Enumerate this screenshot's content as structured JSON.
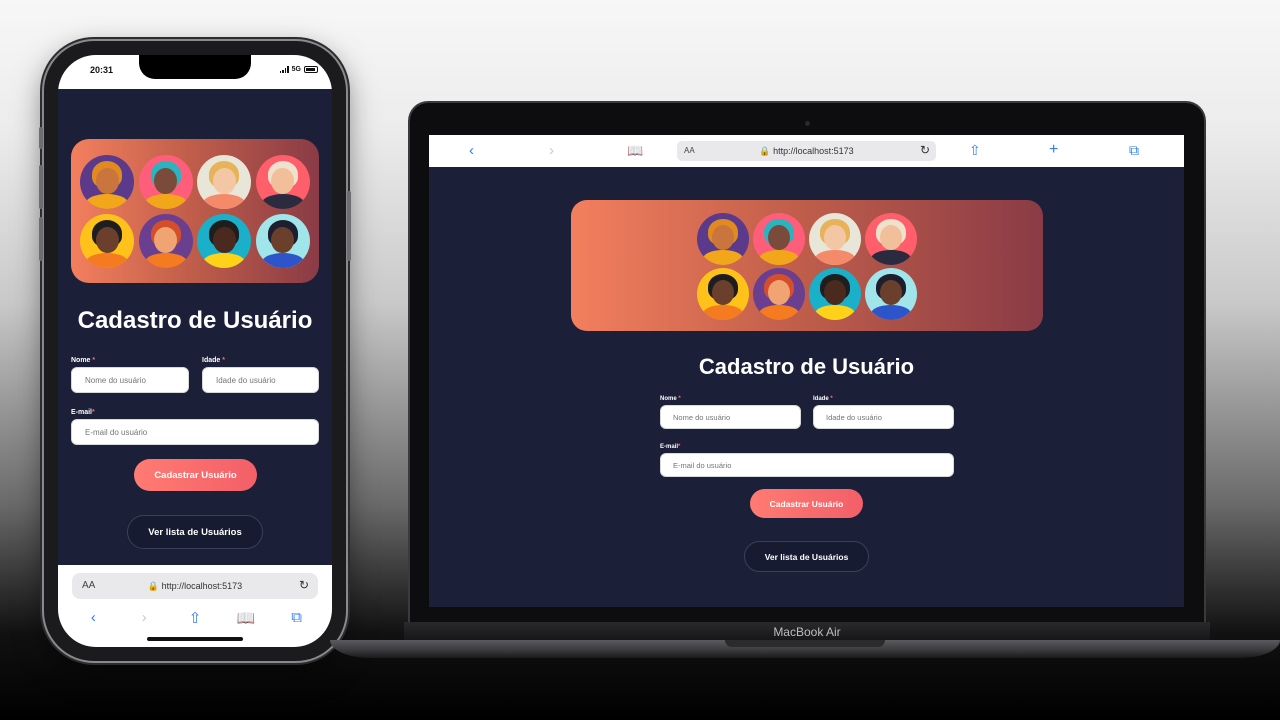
{
  "phone": {
    "status": {
      "time": "20:31",
      "network": "5G"
    },
    "app": {
      "title": "Cadastro de Usuário",
      "name_label": "Nome",
      "age_label": "Idade",
      "email_label": "E-mail",
      "required_mark": "*",
      "name_placeholder": "Nome do usuário",
      "age_placeholder": "Idade do usuário",
      "email_placeholder": "E-mail do usuário",
      "submit_label": "Cadastrar Usuário",
      "list_label": "Ver lista de Usuários"
    },
    "browser": {
      "aa": "AA",
      "url": "http://localhost:5173"
    }
  },
  "laptop": {
    "browser": {
      "aa": "AA",
      "url": "http://localhost:5173"
    },
    "app": {
      "title": "Cadastro de Usuário",
      "name_label": "Nome",
      "age_label": "Idade",
      "email_label": "E-mail",
      "required_mark": "*",
      "name_placeholder": "Nome do usuário",
      "age_placeholder": "Idade do usuário",
      "email_placeholder": "E-mail do usuário",
      "submit_label": "Cadastrar Usuário",
      "list_label": "Ver lista de Usuários"
    },
    "model": "MacBook Air"
  },
  "avatars": [
    {
      "bg": "#5b3a8c",
      "skin": "#c9753d",
      "hair": "#e08a22",
      "body": "#f2a71b"
    },
    {
      "bg": "#ff5e7a",
      "skin": "#7a4a3a",
      "hair": "#2bb3c0",
      "body": "#f2a71b"
    },
    {
      "bg": "#e8e6d8",
      "skin": "#f3c7a4",
      "hair": "#e6b35a",
      "body": "#f48a6a"
    },
    {
      "bg": "#ff5e6b",
      "skin": "#f1c09a",
      "hair": "#f0e1cc",
      "body": "#2b2b3f"
    },
    {
      "bg": "#ffc21a",
      "skin": "#6a3f2c",
      "hair": "#1e1e1e",
      "body": "#f47b20"
    },
    {
      "bg": "#6b3f8f",
      "skin": "#f0a472",
      "hair": "#d44e2b",
      "body": "#f47b20"
    },
    {
      "bg": "#1bb0c9",
      "skin": "#4a2a1e",
      "hair": "#1e1e1e",
      "body": "#ffd21a"
    },
    {
      "bg": "#9fe5ea",
      "skin": "#6a3f2c",
      "hair": "#1e1e2e",
      "body": "#2d54c9"
    }
  ],
  "colors": {
    "app_bg": "#1b2038",
    "accent": "#f35f68",
    "required": "#ff6d6d"
  }
}
